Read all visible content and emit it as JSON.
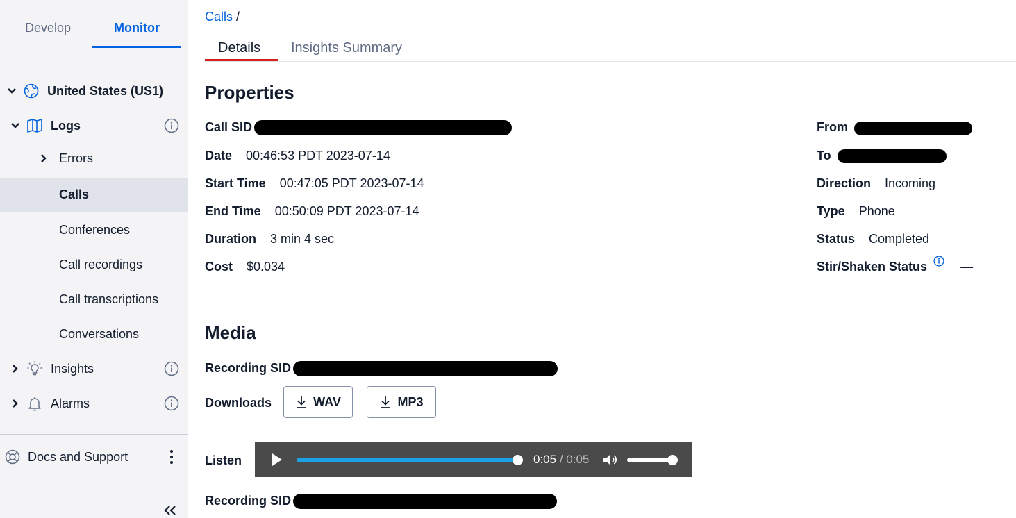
{
  "sidebar": {
    "tabs": {
      "develop": "Develop",
      "monitor": "Monitor"
    },
    "region": "United States (US1)",
    "logs": "Logs",
    "items": {
      "errors": "Errors",
      "calls": "Calls",
      "conferences": "Conferences",
      "call_recordings": "Call recordings",
      "call_transcriptions": "Call transcriptions",
      "conversations": "Conversations",
      "insights": "Insights",
      "alarms": "Alarms"
    },
    "docs_support": "Docs and Support",
    "collapse": "«"
  },
  "breadcrumb": {
    "link": "Calls",
    "sep": "/"
  },
  "tabs": {
    "details": "Details",
    "insights_summary": "Insights Summary"
  },
  "properties": {
    "heading": "Properties",
    "call_sid_label": "Call SID",
    "date_label": "Date",
    "date_value": "00:46:53 PDT 2023-07-14",
    "start_label": "Start Time",
    "start_value": "00:47:05 PDT 2023-07-14",
    "end_label": "End Time",
    "end_value": "00:50:09 PDT 2023-07-14",
    "duration_label": "Duration",
    "duration_value": "3 min 4 sec",
    "cost_label": "Cost",
    "cost_value": "$0.034",
    "from_label": "From",
    "to_label": "To",
    "direction_label": "Direction",
    "direction_value": "Incoming",
    "type_label": "Type",
    "type_value": "Phone",
    "status_label": "Status",
    "status_value": "Completed",
    "stir_label": "Stir/Shaken Status",
    "stir_value": "—"
  },
  "media": {
    "heading": "Media",
    "recording_sid_label": "Recording SID",
    "downloads_label": "Downloads",
    "wav": "WAV",
    "mp3": "MP3",
    "listen_label": "Listen",
    "player": {
      "current": "0:05",
      "sep": " / ",
      "duration": "0:05",
      "progress": 1.0,
      "volume": 0.95
    }
  }
}
